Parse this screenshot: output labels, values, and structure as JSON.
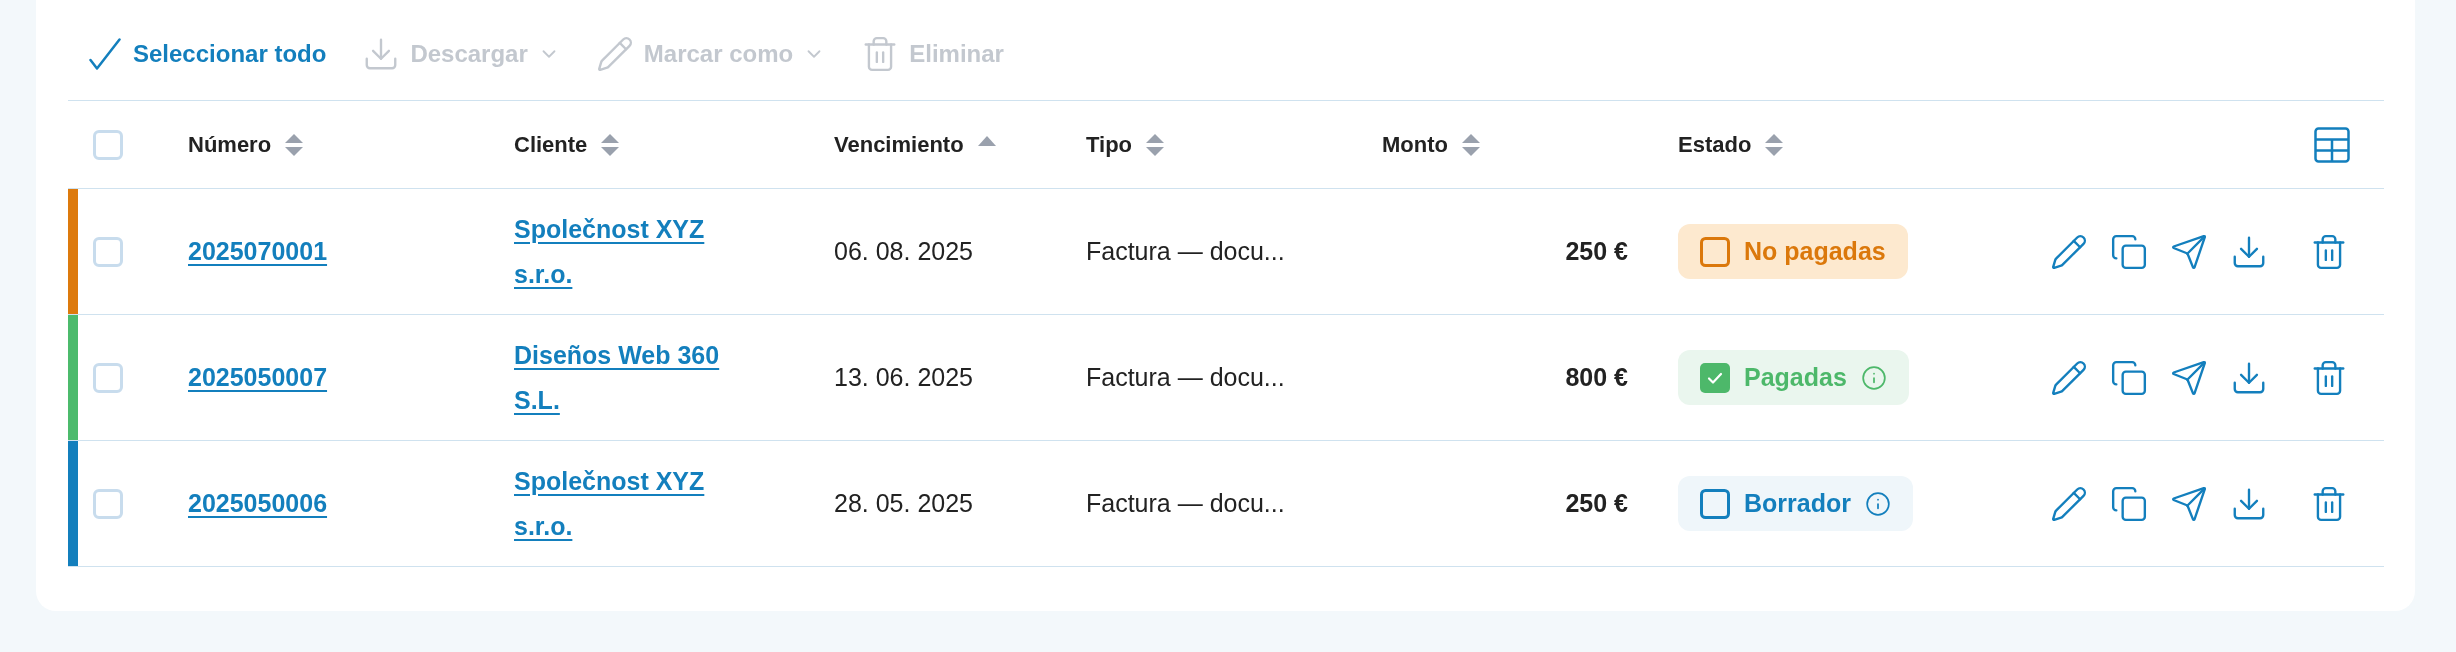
{
  "toolbar": [
    {
      "kind": "select_all",
      "label": "Seleccionar todo",
      "disabled": false,
      "dropdown": false
    },
    {
      "kind": "download",
      "label": "Descargar",
      "disabled": true,
      "dropdown": true
    },
    {
      "kind": "mark",
      "label": "Marcar como",
      "disabled": true,
      "dropdown": true
    },
    {
      "kind": "delete",
      "label": "Eliminar",
      "disabled": true,
      "dropdown": false
    }
  ],
  "table": {
    "select_all_checked": false,
    "columns": [
      {
        "label": "Número",
        "sorted": false
      },
      {
        "label": "Cliente",
        "sorted": false
      },
      {
        "label": "Vencimiento",
        "sorted": true
      },
      {
        "label": "Tipo",
        "sorted": false
      },
      {
        "label": "Monto",
        "sorted": false
      },
      {
        "label": "Estado",
        "sorted": false
      }
    ],
    "rows": [
      {
        "color": "#dd7a0d",
        "checked": false,
        "number": "2025070001",
        "client": "Společnost XYZ s.r.o.",
        "due": "06. 08. 2025",
        "type": "Factura — docu...",
        "amount": "250 €",
        "status": {
          "kind": "unpaid",
          "label": "No pagadas",
          "checked": false,
          "info": false
        }
      },
      {
        "color": "#4cbb6c",
        "checked": false,
        "number": "2025050007",
        "client": "Diseños Web 360 S.L.",
        "due": "13. 06. 2025",
        "type": "Factura — docu...",
        "amount": "800 €",
        "status": {
          "kind": "paid",
          "label": "Pagadas",
          "checked": true,
          "info": true
        }
      },
      {
        "color": "#137fbd",
        "checked": false,
        "number": "2025050006",
        "client": "Společnost XYZ s.r.o.",
        "due": "28. 05. 2025",
        "type": "Factura — docu...",
        "amount": "250 €",
        "status": {
          "kind": "draft",
          "label": "Borrador",
          "checked": false,
          "info": true
        }
      }
    ]
  }
}
